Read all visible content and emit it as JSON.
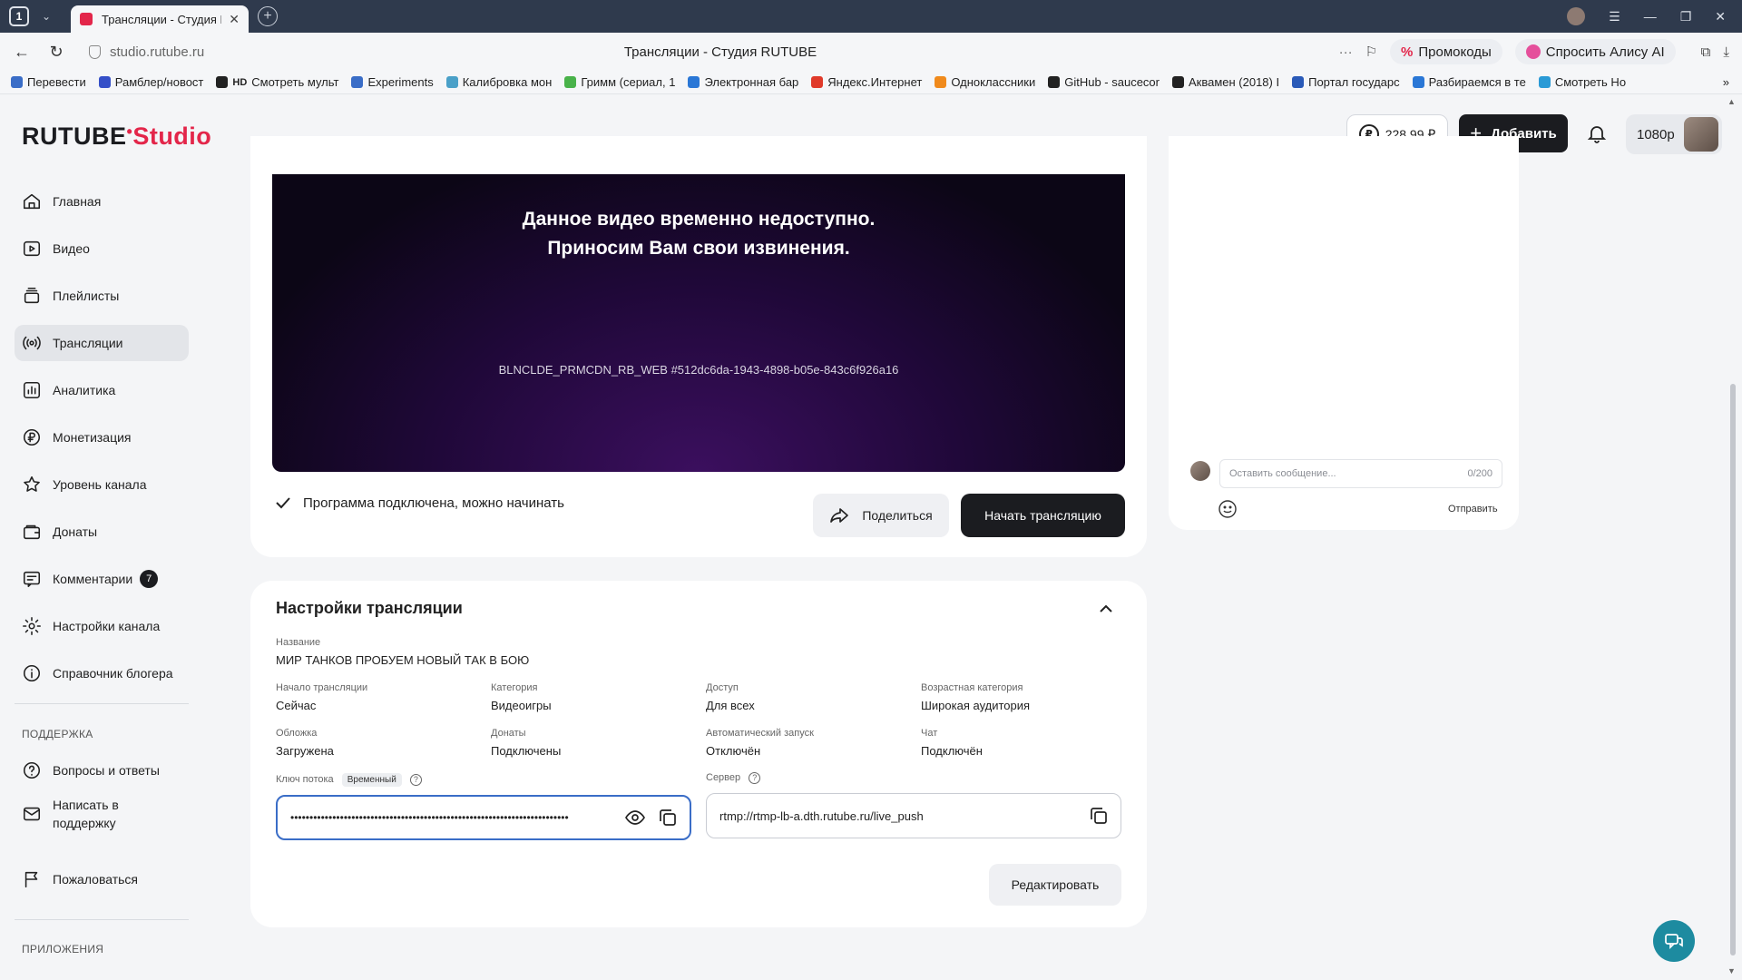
{
  "browser": {
    "tab_count": "1",
    "tab_title": "Трансляции - Студия R",
    "url": "studio.rutube.ru",
    "page_title": "Трансляции - Студия RUTUBE",
    "promo_label": "Промокоды",
    "alice_label": "Спросить Алису AI",
    "bookmarks": [
      {
        "label": "Перевести",
        "color": "#3a6dc7"
      },
      {
        "label": "Рамблер/новост",
        "color": "#3550c8"
      },
      {
        "label": "Смотреть мульт",
        "color": "#222222"
      },
      {
        "label": "Experiments",
        "color": "#3a6dc7"
      },
      {
        "label": "Калибровка мон",
        "color": "#4aa0c8"
      },
      {
        "label": "Гримм (сериал, 1",
        "color": "#49b24a"
      },
      {
        "label": "Электронная бар",
        "color": "#2a77d6"
      },
      {
        "label": "Яндекс.Интернет",
        "color": "#e03a2a"
      },
      {
        "label": "Одноклассники",
        "color": "#f08a1c"
      },
      {
        "label": "GitHub - saucecor",
        "color": "#222222"
      },
      {
        "label": "Аквамен (2018) I",
        "color": "#222222"
      },
      {
        "label": "Портал государс",
        "color": "#2a5ab8"
      },
      {
        "label": "Разбираемся в те",
        "color": "#2a77d6"
      },
      {
        "label": "Смотреть Но",
        "color": "#2a9ad6"
      }
    ],
    "bookmark_prefix_hd": "HD"
  },
  "header": {
    "logo_main": "RUTUBE",
    "logo_studio": "Studio",
    "balance": "228,99 ₽",
    "add_label": "Добавить",
    "quality": "1080p"
  },
  "sidebar": {
    "items": [
      {
        "label": "Главная",
        "icon": "home-icon"
      },
      {
        "label": "Видео",
        "icon": "video-icon"
      },
      {
        "label": "Плейлисты",
        "icon": "playlist-icon"
      },
      {
        "label": "Трансляции",
        "icon": "broadcast-icon"
      },
      {
        "label": "Аналитика",
        "icon": "analytics-icon"
      },
      {
        "label": "Монетизация",
        "icon": "ruble-icon"
      },
      {
        "label": "Уровень канала",
        "icon": "star-icon"
      },
      {
        "label": "Донаты",
        "icon": "wallet-icon"
      },
      {
        "label": "Комментарии",
        "icon": "comment-icon",
        "badge": "7"
      },
      {
        "label": "Настройки канала",
        "icon": "gear-icon"
      },
      {
        "label": "Справочник блогера",
        "icon": "info-icon"
      }
    ],
    "support_title": "ПОДДЕРЖКА",
    "support_items": [
      {
        "label": "Вопросы и ответы",
        "icon": "question-icon"
      },
      {
        "label": "Написать в поддержку",
        "icon": "mail-icon"
      },
      {
        "label": "Пожаловаться",
        "icon": "flag-icon"
      }
    ],
    "apps_title": "ПРИЛОЖЕНИЯ"
  },
  "player": {
    "message_line1": "Данное видео временно недоступно.",
    "message_line2": "Приносим Вам свои извинения.",
    "error_code": "BLNCLDE_PRMCDN_RB_WEB #512dc6da-1943-4898-b05e-843c6f926a16"
  },
  "status": {
    "text": "Программа подключена, можно начинать",
    "share_label": "Поделиться",
    "start_label": "Начать трансляцию"
  },
  "settings": {
    "title": "Настройки трансляции",
    "name_label": "Название",
    "name_value": "МИР ТАНКОВ ПРОБУЕМ НОВЫЙ ТАК В БОЮ",
    "fields": [
      {
        "label": "Начало трансляции",
        "value": "Сейчас"
      },
      {
        "label": "Категория",
        "value": "Видеоигры"
      },
      {
        "label": "Доступ",
        "value": "Для всех"
      },
      {
        "label": "Возрастная категория",
        "value": "Широкая аудитория"
      },
      {
        "label": "Обложка",
        "value": "Загружена"
      },
      {
        "label": "Донаты",
        "value": "Подключены"
      },
      {
        "label": "Автоматический запуск",
        "value": "Отключён"
      },
      {
        "label": "Чат",
        "value": "Подключён"
      }
    ],
    "stream_key_label": "Ключ потока",
    "stream_key_tag": "Временный",
    "stream_key_value": "•••••••••••••••••••••••••••••••••••••••••••••••••••••••••••••••••••••••••",
    "server_label": "Сервер",
    "server_value": "rtmp://rtmp-lb-a.dth.rutube.ru/live_push",
    "edit_label": "Редактировать"
  },
  "chat": {
    "placeholder": "Оставить сообщение...",
    "counter": "0/200",
    "send_label": "Отправить"
  }
}
